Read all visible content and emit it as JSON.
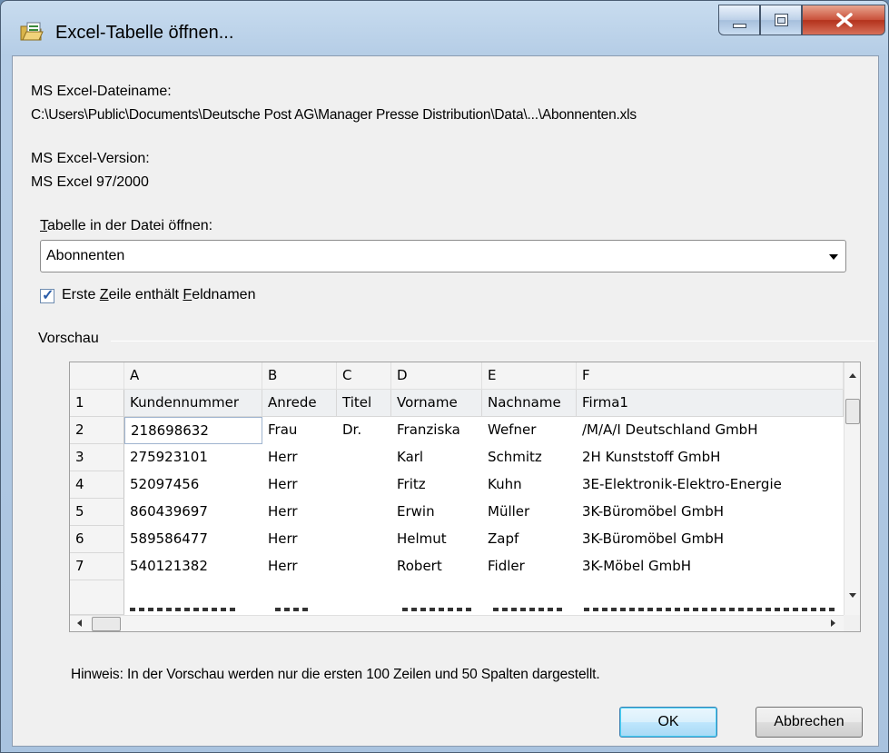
{
  "window": {
    "title": "Excel-Tabelle öffnen...",
    "icon": "excel-folder-icon",
    "controls": [
      "minimize-icon",
      "maximize-icon",
      "close-icon"
    ]
  },
  "file": {
    "label": "MS Excel-Dateiname:",
    "path": "C:\\Users\\Public\\Documents\\Deutsche Post AG\\Manager Presse Distribution\\Data\\...\\Abonnenten.xls"
  },
  "version": {
    "label": "MS Excel-Version:",
    "value": "MS Excel 97/2000"
  },
  "sheet": {
    "label_access_key": "T",
    "label_rest": "abelle in der Datei öffnen:",
    "selected": "Abonnenten"
  },
  "header_checkbox": {
    "checked": true,
    "label_part1": "Erste ",
    "label_key1": "Z",
    "label_part2": "eile enthält ",
    "label_key2": "F",
    "label_part3": "eldnamen"
  },
  "preview": {
    "group_label": "Vorschau",
    "columns": [
      "A",
      "B",
      "C",
      "D",
      "E",
      "F"
    ],
    "rows": [
      {
        "num": "1",
        "cells": [
          "Kundennummer",
          "Anrede",
          "Titel",
          "Vorname",
          "Nachname",
          "Firma1"
        ]
      },
      {
        "num": "2",
        "cells": [
          "218698632",
          "Frau",
          "Dr.",
          "Franziska",
          "Wefner",
          "/M/A/I Deutschland GmbH"
        ]
      },
      {
        "num": "3",
        "cells": [
          "275923101",
          "Herr",
          "",
          "Karl",
          "Schmitz",
          "2H Kunststoff GmbH"
        ]
      },
      {
        "num": "4",
        "cells": [
          "52097456",
          "Herr",
          "",
          "Fritz",
          "Kuhn",
          "3E-Elektronik-Elektro-Energie"
        ]
      },
      {
        "num": "5",
        "cells": [
          "860439697",
          "Herr",
          "",
          "Erwin",
          "Müller",
          "3K-Büromöbel GmbH"
        ]
      },
      {
        "num": "6",
        "cells": [
          "589586477",
          "Herr",
          "",
          "Helmut",
          "Zapf",
          "3K-Büromöbel GmbH"
        ]
      },
      {
        "num": "7",
        "cells": [
          "540121382",
          "Herr",
          "",
          "Robert",
          "Fidler",
          "3K-Möbel GmbH"
        ]
      }
    ]
  },
  "hint": "Hinweis: In der Vorschau werden nur die ersten 100 Zeilen und 50 Spalten dargestellt.",
  "buttons": {
    "ok": "OK",
    "cancel": "Abbrechen"
  }
}
